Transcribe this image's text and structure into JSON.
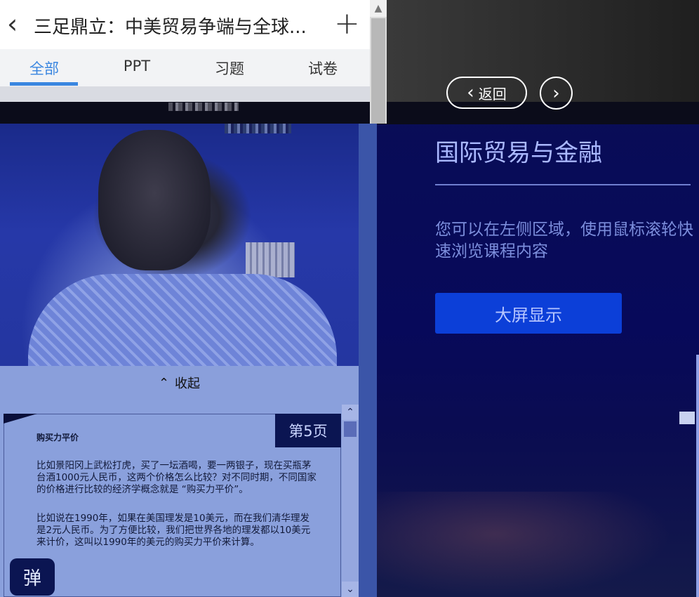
{
  "app": {
    "title": "三足鼎立：中美贸易争端与全球...",
    "tabs": [
      {
        "label": "全部",
        "active": true
      },
      {
        "label": "PPT",
        "active": false
      },
      {
        "label": "习题",
        "active": false
      },
      {
        "label": "试卷",
        "active": false
      }
    ]
  },
  "course": {
    "back_label": "返回",
    "title": "国际贸易与金融",
    "hint": "您可以在左侧区域，使用鼠标滚轮快速浏览课程内容",
    "bigscreen_label": "大屏显示"
  },
  "player": {
    "collapse_label": "收起"
  },
  "slide": {
    "page_label": "第5页",
    "heading": "购买力平价",
    "para1": "比如景阳冈上武松打虎，买了一坛酒喝，要一两银子，现在买瓶茅台酒1000元人民币，这两个价格怎么比较？对不同时期，不同国家的价格进行比较的经济学概念就是 “购买力平价”。",
    "para2": "比如说在1990年，如果在美国理发是10美元，而在我们清华理发是2元人民币。为了方便比较，我们把世界各地的理发都以10美元来计价，这叫以1990年的美元的购买力平价来计算。"
  },
  "danmu": {
    "label": "弹"
  },
  "colors": {
    "accent": "#3a86e0",
    "bigscreen_bg": "#0c3fd8",
    "course_bg": "#07095a",
    "slide_bg": "#8aa0dc",
    "badge_bg": "#0b1552"
  }
}
